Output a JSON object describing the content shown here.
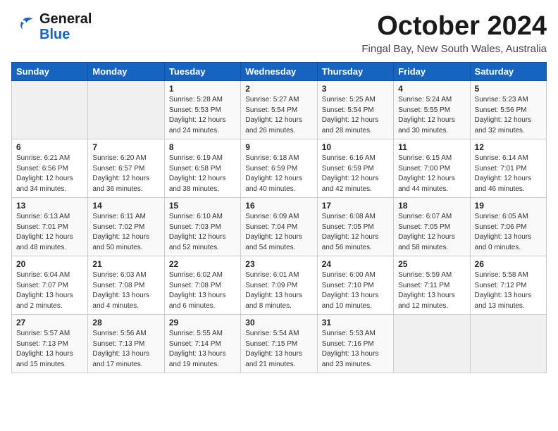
{
  "header": {
    "logo_general": "General",
    "logo_blue": "Blue",
    "month_title": "October 2024",
    "location": "Fingal Bay, New South Wales, Australia"
  },
  "weekdays": [
    "Sunday",
    "Monday",
    "Tuesday",
    "Wednesday",
    "Thursday",
    "Friday",
    "Saturday"
  ],
  "weeks": [
    [
      {
        "day": "",
        "info": ""
      },
      {
        "day": "",
        "info": ""
      },
      {
        "day": "1",
        "info": "Sunrise: 5:28 AM\nSunset: 5:53 PM\nDaylight: 12 hours\nand 24 minutes."
      },
      {
        "day": "2",
        "info": "Sunrise: 5:27 AM\nSunset: 5:54 PM\nDaylight: 12 hours\nand 26 minutes."
      },
      {
        "day": "3",
        "info": "Sunrise: 5:25 AM\nSunset: 5:54 PM\nDaylight: 12 hours\nand 28 minutes."
      },
      {
        "day": "4",
        "info": "Sunrise: 5:24 AM\nSunset: 5:55 PM\nDaylight: 12 hours\nand 30 minutes."
      },
      {
        "day": "5",
        "info": "Sunrise: 5:23 AM\nSunset: 5:56 PM\nDaylight: 12 hours\nand 32 minutes."
      }
    ],
    [
      {
        "day": "6",
        "info": "Sunrise: 6:21 AM\nSunset: 6:56 PM\nDaylight: 12 hours\nand 34 minutes."
      },
      {
        "day": "7",
        "info": "Sunrise: 6:20 AM\nSunset: 6:57 PM\nDaylight: 12 hours\nand 36 minutes."
      },
      {
        "day": "8",
        "info": "Sunrise: 6:19 AM\nSunset: 6:58 PM\nDaylight: 12 hours\nand 38 minutes."
      },
      {
        "day": "9",
        "info": "Sunrise: 6:18 AM\nSunset: 6:59 PM\nDaylight: 12 hours\nand 40 minutes."
      },
      {
        "day": "10",
        "info": "Sunrise: 6:16 AM\nSunset: 6:59 PM\nDaylight: 12 hours\nand 42 minutes."
      },
      {
        "day": "11",
        "info": "Sunrise: 6:15 AM\nSunset: 7:00 PM\nDaylight: 12 hours\nand 44 minutes."
      },
      {
        "day": "12",
        "info": "Sunrise: 6:14 AM\nSunset: 7:01 PM\nDaylight: 12 hours\nand 46 minutes."
      }
    ],
    [
      {
        "day": "13",
        "info": "Sunrise: 6:13 AM\nSunset: 7:01 PM\nDaylight: 12 hours\nand 48 minutes."
      },
      {
        "day": "14",
        "info": "Sunrise: 6:11 AM\nSunset: 7:02 PM\nDaylight: 12 hours\nand 50 minutes."
      },
      {
        "day": "15",
        "info": "Sunrise: 6:10 AM\nSunset: 7:03 PM\nDaylight: 12 hours\nand 52 minutes."
      },
      {
        "day": "16",
        "info": "Sunrise: 6:09 AM\nSunset: 7:04 PM\nDaylight: 12 hours\nand 54 minutes."
      },
      {
        "day": "17",
        "info": "Sunrise: 6:08 AM\nSunset: 7:05 PM\nDaylight: 12 hours\nand 56 minutes."
      },
      {
        "day": "18",
        "info": "Sunrise: 6:07 AM\nSunset: 7:05 PM\nDaylight: 12 hours\nand 58 minutes."
      },
      {
        "day": "19",
        "info": "Sunrise: 6:05 AM\nSunset: 7:06 PM\nDaylight: 13 hours\nand 0 minutes."
      }
    ],
    [
      {
        "day": "20",
        "info": "Sunrise: 6:04 AM\nSunset: 7:07 PM\nDaylight: 13 hours\nand 2 minutes."
      },
      {
        "day": "21",
        "info": "Sunrise: 6:03 AM\nSunset: 7:08 PM\nDaylight: 13 hours\nand 4 minutes."
      },
      {
        "day": "22",
        "info": "Sunrise: 6:02 AM\nSunset: 7:08 PM\nDaylight: 13 hours\nand 6 minutes."
      },
      {
        "day": "23",
        "info": "Sunrise: 6:01 AM\nSunset: 7:09 PM\nDaylight: 13 hours\nand 8 minutes."
      },
      {
        "day": "24",
        "info": "Sunrise: 6:00 AM\nSunset: 7:10 PM\nDaylight: 13 hours\nand 10 minutes."
      },
      {
        "day": "25",
        "info": "Sunrise: 5:59 AM\nSunset: 7:11 PM\nDaylight: 13 hours\nand 12 minutes."
      },
      {
        "day": "26",
        "info": "Sunrise: 5:58 AM\nSunset: 7:12 PM\nDaylight: 13 hours\nand 13 minutes."
      }
    ],
    [
      {
        "day": "27",
        "info": "Sunrise: 5:57 AM\nSunset: 7:13 PM\nDaylight: 13 hours\nand 15 minutes."
      },
      {
        "day": "28",
        "info": "Sunrise: 5:56 AM\nSunset: 7:13 PM\nDaylight: 13 hours\nand 17 minutes."
      },
      {
        "day": "29",
        "info": "Sunrise: 5:55 AM\nSunset: 7:14 PM\nDaylight: 13 hours\nand 19 minutes."
      },
      {
        "day": "30",
        "info": "Sunrise: 5:54 AM\nSunset: 7:15 PM\nDaylight: 13 hours\nand 21 minutes."
      },
      {
        "day": "31",
        "info": "Sunrise: 5:53 AM\nSunset: 7:16 PM\nDaylight: 13 hours\nand 23 minutes."
      },
      {
        "day": "",
        "info": ""
      },
      {
        "day": "",
        "info": ""
      }
    ]
  ]
}
